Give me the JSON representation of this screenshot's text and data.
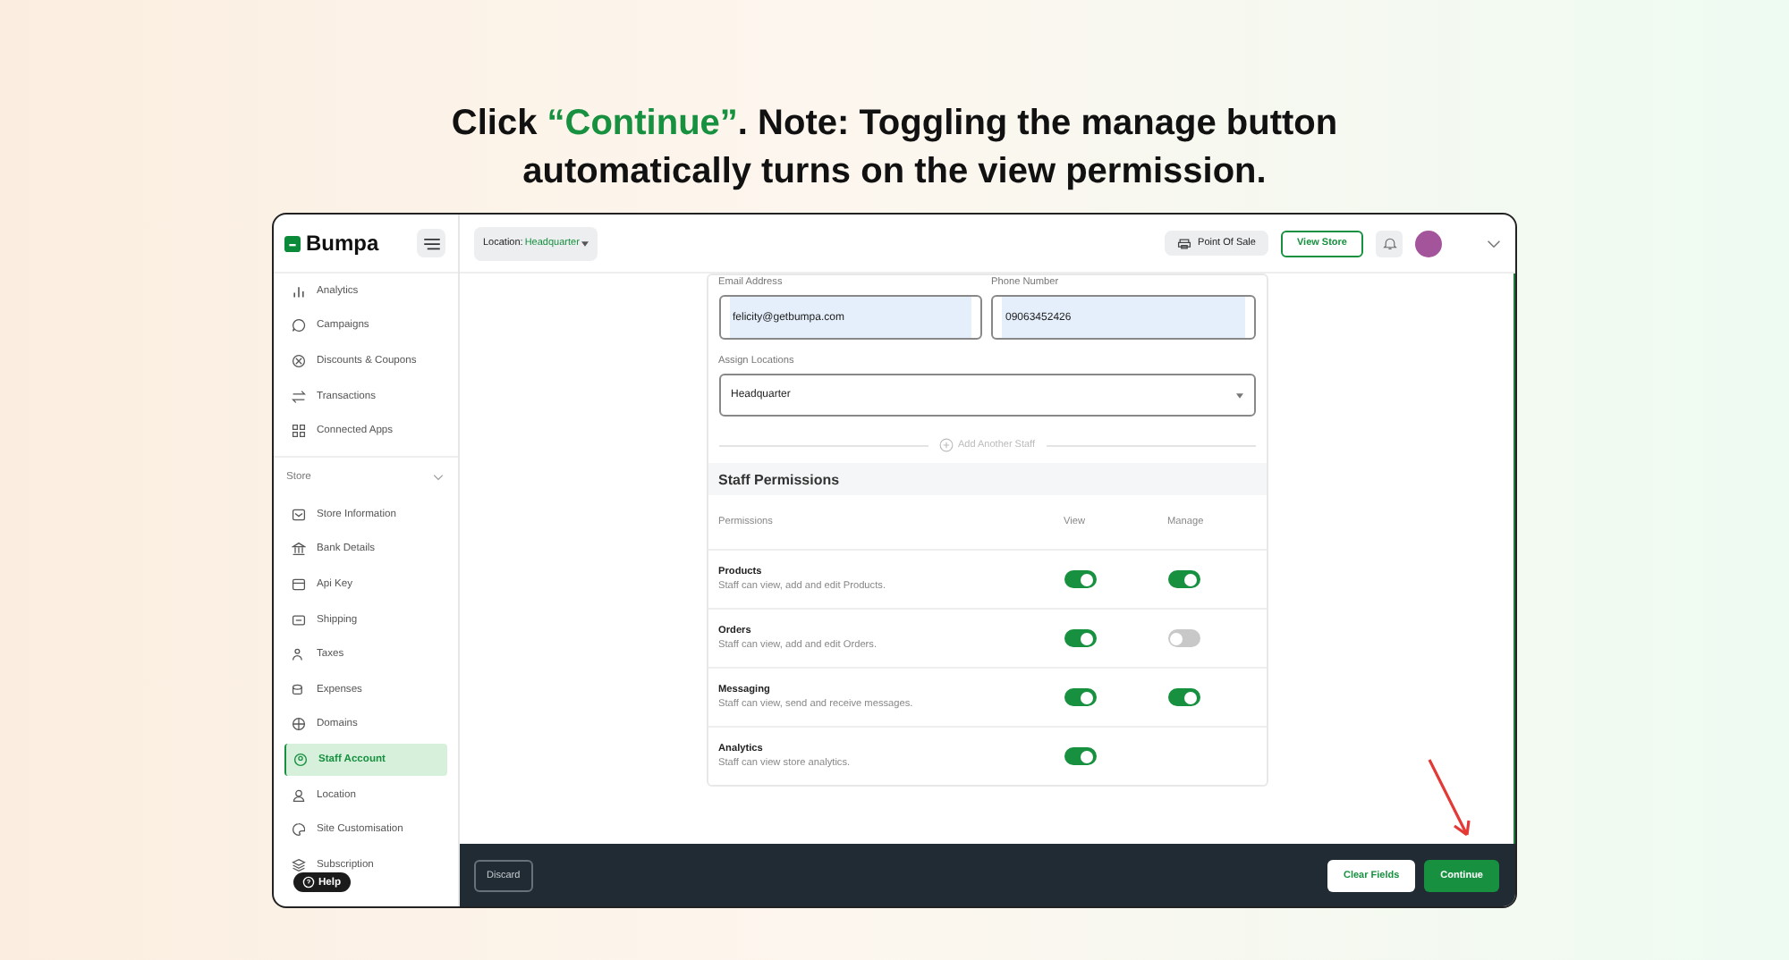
{
  "heading": {
    "before": "Click ",
    "highlight": "“Continue”",
    "after": ". Note: Toggling the manage button automatically turns on the view permission."
  },
  "app": {
    "logo": "Bumpa",
    "topbar": {
      "location_label": "Location:",
      "location_value": "Headquarter",
      "pos_button": "Point Of Sale",
      "view_store_button": "View Store"
    },
    "sidebar": {
      "items": [
        {
          "label": "Analytics",
          "selected": false
        },
        {
          "label": "Campaigns",
          "selected": false
        },
        {
          "label": "Discounts & Coupons",
          "selected": false
        },
        {
          "label": "Transactions",
          "selected": false
        },
        {
          "label": "Connected Apps",
          "selected": false
        }
      ],
      "group": {
        "label": "Store",
        "expanded": true,
        "items": [
          {
            "label": "Store Information",
            "selected": false
          },
          {
            "label": "Bank Details",
            "selected": false
          },
          {
            "label": "Api Key",
            "selected": false
          },
          {
            "label": "Shipping",
            "selected": false
          },
          {
            "label": "Taxes",
            "selected": false
          },
          {
            "label": "Expenses",
            "selected": false
          },
          {
            "label": "Domains",
            "selected": false
          },
          {
            "label": "Staff Account",
            "selected": true
          },
          {
            "label": "Location",
            "selected": false
          },
          {
            "label": "Site Customisation",
            "selected": false
          },
          {
            "label": "Subscription",
            "selected": false
          }
        ]
      },
      "help_button": "Help"
    },
    "form": {
      "email_label": "Email Address",
      "email_value": "felicity@getbumpa.com",
      "phone_label": "Phone Number",
      "phone_value": "09063452426",
      "locations_label": "Assign Locations",
      "locations_value": "Headquarter",
      "add_staff": "Add Another Staff"
    },
    "permissions": {
      "title": "Staff Permissions",
      "columns": [
        "Permissions",
        "View",
        "Manage"
      ],
      "rows": [
        {
          "name": "Products",
          "description": "Staff can view, add and edit Products.",
          "view_on": true,
          "manage_on": true
        },
        {
          "name": "Orders",
          "description": "Staff can view, add and edit Orders.",
          "view_on": true,
          "manage_on": false
        },
        {
          "name": "Messaging",
          "description": "Staff can view, send and receive messages.",
          "view_on": true,
          "manage_on": true
        },
        {
          "name": "Analytics",
          "description": "Staff can view store analytics.",
          "view_on": true
        }
      ]
    },
    "footer": {
      "discard": "Discard",
      "clear": "Clear Fields",
      "continue": "Continue"
    }
  }
}
